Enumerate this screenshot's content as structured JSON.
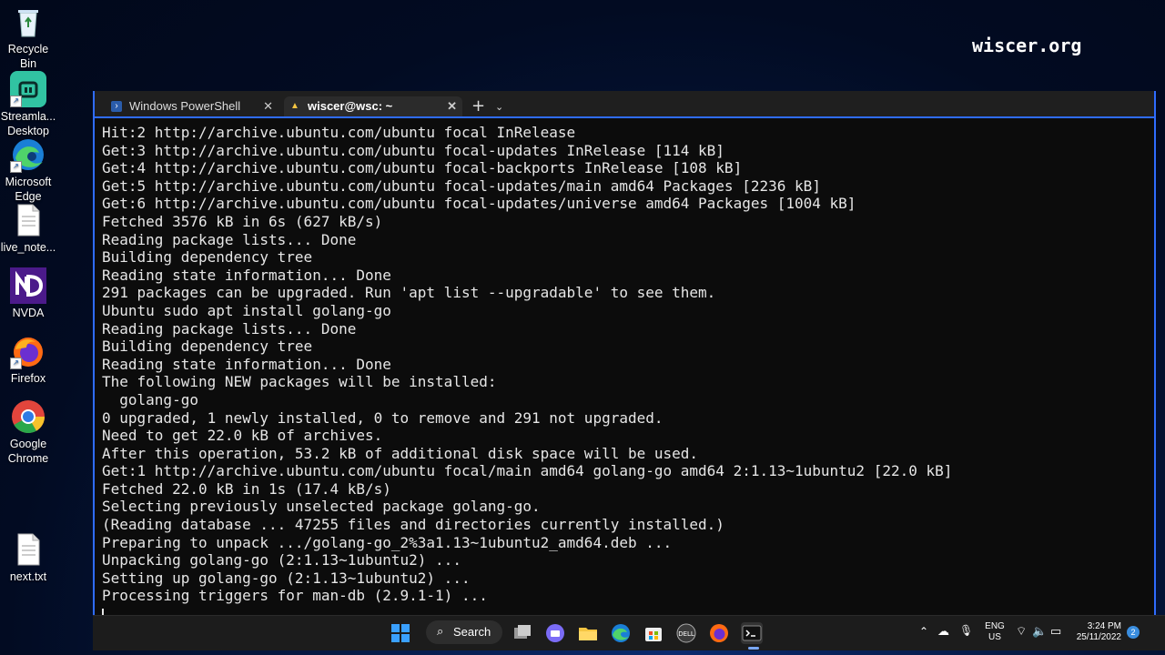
{
  "desktop": {
    "icons": [
      {
        "label": "Recycle Bin",
        "icon": "recycle-bin-icon"
      },
      {
        "label": "Streamla... Desktop",
        "icon": "streamlabs-icon"
      },
      {
        "label": "Microsoft Edge",
        "icon": "edge-icon"
      },
      {
        "label": "live_note...",
        "icon": "text-file-icon"
      },
      {
        "label": "NVDA",
        "icon": "nvda-icon"
      },
      {
        "label": "Firefox",
        "icon": "firefox-icon"
      },
      {
        "label": "Google Chrome",
        "icon": "chrome-icon"
      },
      {
        "label": "next.txt",
        "icon": "text-file-icon"
      }
    ]
  },
  "watermark": "wiscer.org",
  "terminal": {
    "tabs": [
      {
        "label": "Windows PowerShell",
        "icon": "powershell-icon",
        "active": false
      },
      {
        "label": "wiscer@wsc: ~",
        "icon": "linux-penguin-icon",
        "active": true
      }
    ],
    "add_tab": "+",
    "dropdown": "⌄",
    "lines": [
      "Hit:2 http://archive.ubuntu.com/ubuntu focal InRelease",
      "Get:3 http://archive.ubuntu.com/ubuntu focal-updates InRelease [114 kB]",
      "Get:4 http://archive.ubuntu.com/ubuntu focal-backports InRelease [108 kB]",
      "Get:5 http://archive.ubuntu.com/ubuntu focal-updates/main amd64 Packages [2236 kB]",
      "Get:6 http://archive.ubuntu.com/ubuntu focal-updates/universe amd64 Packages [1004 kB]",
      "Fetched 3576 kB in 6s (627 kB/s)",
      "Reading package lists... Done",
      "Building dependency tree",
      "Reading state information... Done",
      "291 packages can be upgraded. Run 'apt list --upgradable' to see them.",
      "Ubuntu sudo apt install golang-go",
      "Reading package lists... Done",
      "Building dependency tree",
      "Reading state information... Done",
      "The following NEW packages will be installed:",
      "  golang-go",
      "0 upgraded, 1 newly installed, 0 to remove and 291 not upgraded.",
      "Need to get 22.0 kB of archives.",
      "After this operation, 53.2 kB of additional disk space will be used.",
      "Get:1 http://archive.ubuntu.com/ubuntu focal/main amd64 golang-go amd64 2:1.13~1ubuntu2 [22.0 kB]",
      "Fetched 22.0 kB in 1s (17.4 kB/s)",
      "Selecting previously unselected package golang-go.",
      "(Reading database ... 47255 files and directories currently installed.)",
      "Preparing to unpack .../golang-go_2%3a1.13~1ubuntu2_amd64.deb ...",
      "Unpacking golang-go (2:1.13~1ubuntu2) ...",
      "Setting up golang-go (2:1.13~1ubuntu2) ...",
      "Processing triggers for man-db (2.9.1-1) ..."
    ]
  },
  "taskbar": {
    "search_label": "Search",
    "pinned": [
      "windows-start-icon",
      "search-icon",
      "task-view-icon",
      "teams-chat-icon",
      "file-explorer-icon",
      "edge-icon",
      "microsoft-store-icon",
      "dell-icon",
      "firefox-icon",
      "terminal-icon"
    ],
    "lang_line1": "ENG",
    "lang_line2": "US",
    "time": "3:24 PM",
    "date": "25/11/2022",
    "notification_count": "2"
  }
}
